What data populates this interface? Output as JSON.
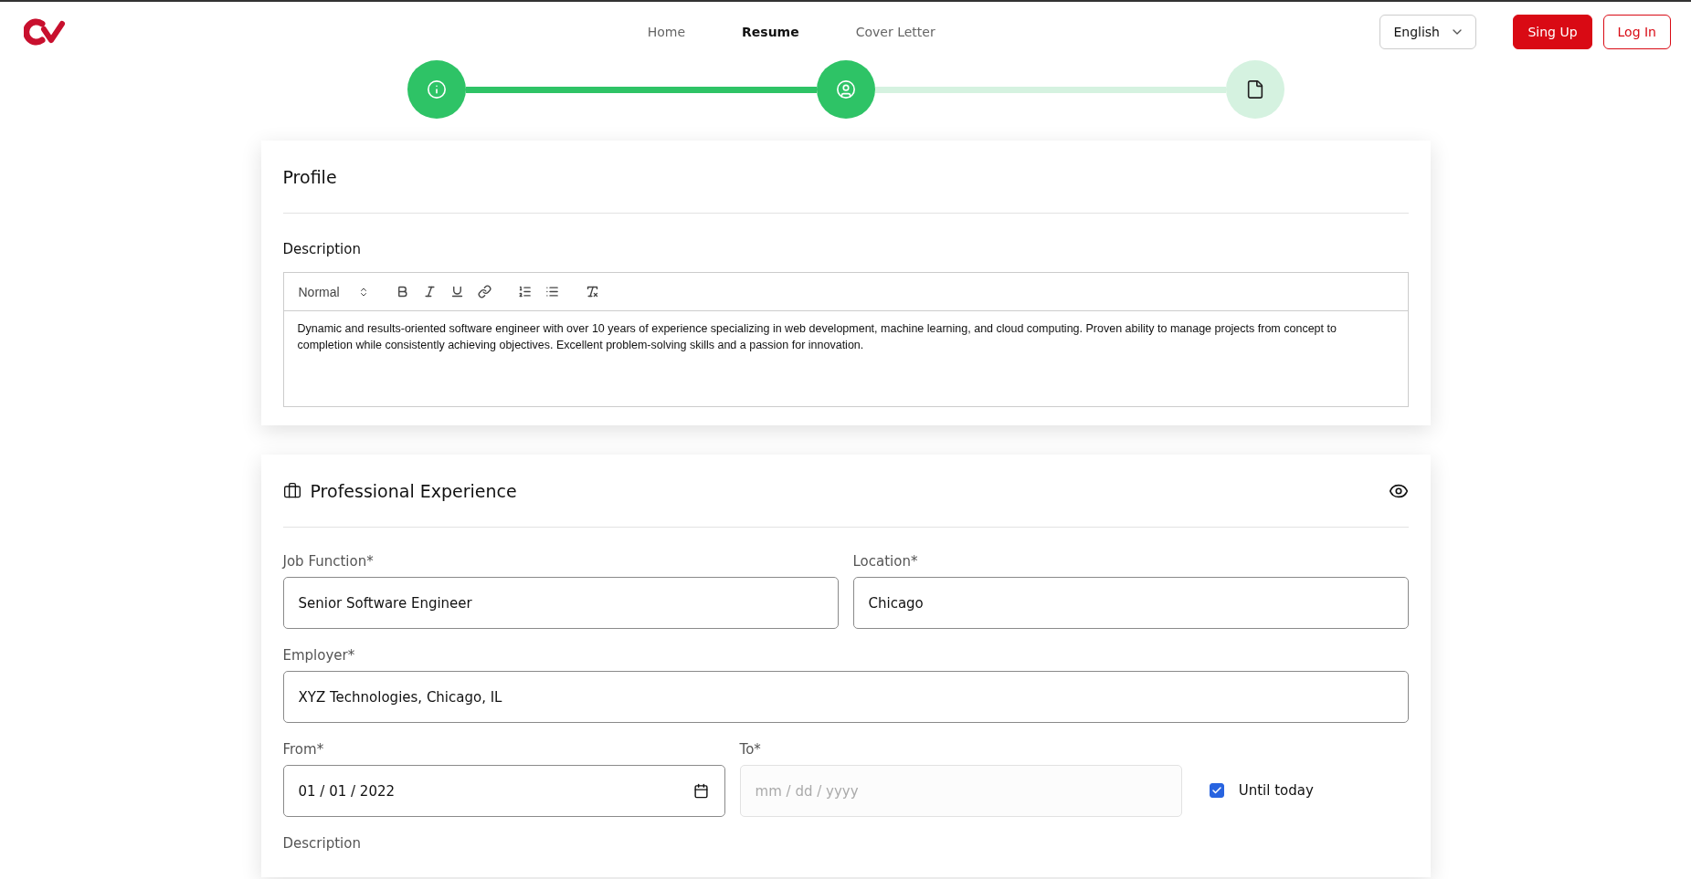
{
  "header": {
    "nav": [
      {
        "label": "Home",
        "selected": false
      },
      {
        "label": "Resume",
        "selected": true
      },
      {
        "label": "Cover Letter",
        "selected": false
      }
    ],
    "language": "English",
    "buttons": [
      {
        "label": "Sing Up",
        "kind": "primary"
      },
      {
        "label": "Log In",
        "kind": "outline"
      }
    ]
  },
  "stepper": [
    {
      "complete": true
    },
    {
      "complete": true
    },
    {
      "complete": false
    }
  ],
  "profile": {
    "title": "Profile",
    "description_label": "Description",
    "editor": {
      "format": "Normal",
      "text": "Dynamic and results-oriented software engineer with over 10 years of experience specializing in web development, machine learning, and cloud computing. Proven ability to manage projects from concept to completion while consistently achieving objectives. Excellent problem-solving skills and a passion for innovation."
    }
  },
  "experience": {
    "title": "Professional Experience",
    "job_function": {
      "label": "Job Function*",
      "value": "Senior Software Engineer"
    },
    "location": {
      "label": "Location*",
      "value": "Chicago"
    },
    "employer": {
      "label": "Employer*",
      "value": "XYZ Technologies, Chicago, IL"
    },
    "from": {
      "label": "From*",
      "value": "01 / 01 / 2022"
    },
    "to": {
      "label": "To*",
      "placeholder": "mm / dd / yyyy",
      "disabled": true
    },
    "until_today": {
      "label": "Until today",
      "checked": true
    },
    "description_label": "Description"
  }
}
